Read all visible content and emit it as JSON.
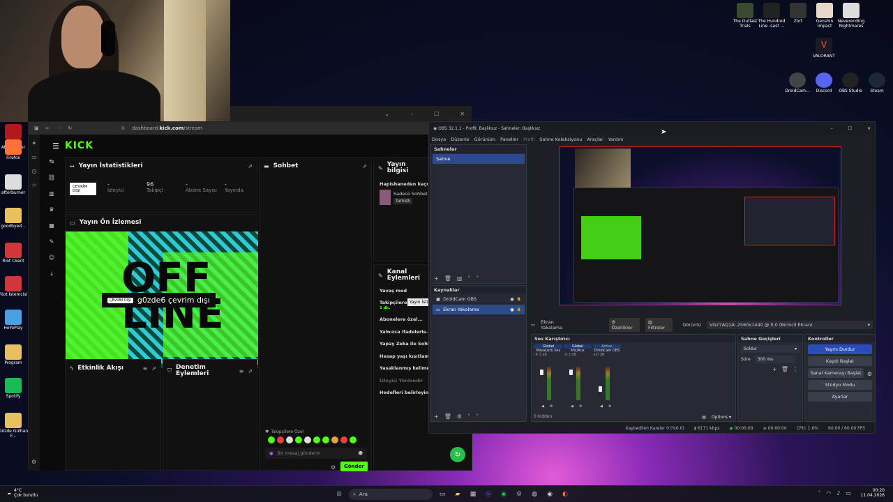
{
  "desktop": {
    "top_icons": [
      {
        "label": "The Outlast Trials",
        "icon": "outlast-icon",
        "color": "#3a4a30"
      },
      {
        "label": "The Hundred Line -Last ...",
        "icon": "hundred-line-icon",
        "color": "#222"
      },
      {
        "label": "Zort",
        "icon": "zort-icon",
        "color": "#333"
      },
      {
        "label": "Genshin Impact",
        "icon": "genshin-icon",
        "color": "#e9d8c9"
      },
      {
        "label": "Neverending Nightmares",
        "icon": "neverending-icon",
        "color": "#ddd"
      }
    ],
    "valorant": {
      "label": "VALORANT",
      "icon": "valorant-icon",
      "color": "#ff4655"
    },
    "mid_icons": [
      {
        "label": "DroidCam...",
        "icon": "droidcam-icon",
        "color": "#444"
      },
      {
        "label": "Discord",
        "icon": "discord-icon",
        "color": "#5865f2"
      },
      {
        "label": "OBS Studio",
        "icon": "obs-icon",
        "color": "#222"
      },
      {
        "label": "Steam",
        "icon": "steam-icon",
        "color": "#1b2838"
      }
    ],
    "left_icons": [
      {
        "label": "MSI Afterburner",
        "icon": "afterburner-icon",
        "color": "#b01a1a"
      },
      {
        "label": "Firefox",
        "icon": "firefox-icon",
        "color": "#ff7139"
      },
      {
        "label": "afterburner",
        "icon": "file-icon",
        "color": "#ddd"
      },
      {
        "label": "goodbyed...",
        "icon": "folder-icon",
        "color": "#e8c060"
      },
      {
        "label": "Riot Client",
        "icon": "riot-icon",
        "color": "#d13639"
      },
      {
        "label": "Riot İstemcisi",
        "icon": "riot-icon",
        "color": "#d13639"
      },
      {
        "label": "HoYoPlay",
        "icon": "hoyoplay-icon",
        "color": "#4aa0e0"
      },
      {
        "label": "Program",
        "icon": "folder-icon",
        "color": "#e8c060"
      },
      {
        "label": "Spotify",
        "icon": "spotify-icon",
        "color": "#1db954"
      },
      {
        "label": "Gözde Gülhan F...",
        "icon": "folder-icon",
        "color": "#e8c060"
      }
    ]
  },
  "browser": {
    "url_prefix": "dashboard.",
    "url_domain": "kick.com",
    "url_path": "/stream",
    "brand": "KICK",
    "stats_title": "Yayın İstatistikleri",
    "offline_badge": "ÇEVRİM DIŞI",
    "stats": [
      {
        "value": "-",
        "label": "İzleyici"
      },
      {
        "value": "96",
        "label": "Takipçi"
      },
      {
        "value": "-",
        "label": "Abone Sayısı"
      },
      {
        "value": "-",
        "label": "Yayında"
      }
    ],
    "preview_title": "Yayın Ön İzlemesi",
    "offline_pill": "ÇEVRİM DIŞI",
    "offline_text": "g0zde6 çevrim dışı",
    "activity_title": "Etkinlik Akışı",
    "moderation_title": "Denetim Eylemleri",
    "chat_title": "Sohbet",
    "chat_followers": "Takipçilere Özel",
    "chat_placeholder": "Bir mesaj gönderin",
    "chat_send": "Gönder",
    "info_title": "Yayın bilgisi",
    "info_stream_title": "Hapishaneden kaçış",
    "info_category": "Sadece Sohbet",
    "info_language": "Turkish",
    "channel_actions_title": "Kanal Eylemleri",
    "tooltip": "Yayın İsti",
    "actions": [
      {
        "label": "Yavaş mod"
      },
      {
        "label": "Takipçilere özel sohbet",
        "sub": "1 dk."
      },
      {
        "label": "Abonelere özel..."
      },
      {
        "label": "Yalnızca ifadelerle..."
      },
      {
        "label": "Yapay Zeka ile Sohbet Denetimi"
      },
      {
        "label": "Hesap yaşı kısıtlaması"
      },
      {
        "label": "Yasaklanmış kelimeler"
      },
      {
        "label": "İzleyici Yönlendir"
      },
      {
        "label": "Hedefleri belirleyin"
      }
    ]
  },
  "obs": {
    "title": "OBS 32.1.1 - Profil: Başlıksız - Sahneler: Başlıksız",
    "menu": [
      "Dosya",
      "Düzenle",
      "Görünüm",
      "Paneller",
      "Profil",
      "Sahne Koleksiyonu",
      "Araçlar",
      "Yardım"
    ],
    "scenes_title": "Sahneler",
    "scenes": [
      "Sahne"
    ],
    "sources_title": "Kaynaklar",
    "sources": [
      "DroidCam OBS",
      "Ekran Yakalama"
    ],
    "selected_source": "Ekran Yakalama",
    "props_btn": "Özellikler",
    "filters_btn": "Filtreler",
    "display_label": "Görüntü",
    "display_value": "VG27AQ1A: 2560x1440 @ 0,0 (Birincil Ekran)",
    "mixer_title": "Ses Karıştırıcı",
    "mixer_channels": [
      {
        "badge": "Global",
        "name": "Masaüstü Ses",
        "db": "-4.3 dB"
      },
      {
        "badge": "Global",
        "name": "Mic/Aux",
        "db": "-5.3 dB"
      },
      {
        "badge": "Active",
        "name": "DroidCam OBS",
        "db": "-inf dB"
      }
    ],
    "hidden_label": "0 hidden",
    "options_label": "Options",
    "transitions_title": "Sahne Geçişleri",
    "transition_value": "Soldur",
    "duration_label": "Süre",
    "duration_value": "300 ms",
    "controls_title": "Kontroller",
    "controls": [
      "Yayını Durdur",
      "Kaydı Başlat",
      "Sanal Kamerayı Başlat",
      "Stüdyo Modu",
      "Ayarlar"
    ],
    "status": {
      "dropped": "Kaybedilen Kareler 0 (%0.0)",
      "bitrate": "6171 kbps",
      "live_time": "00:00:09",
      "rec_time": "00:00:00",
      "cpu": "CPU: 1.6%",
      "fps": "60.00 / 60.00 FPS"
    }
  },
  "taskbar": {
    "weather_temp": "4°C",
    "weather_desc": "Çok bulutlu",
    "search_placeholder": "Ara",
    "time": "00:20",
    "date": "11.04.2026"
  },
  "colors": {
    "kick_green": "#53fc18",
    "obs_blue": "#284cb8",
    "record_red": "#d02020"
  }
}
